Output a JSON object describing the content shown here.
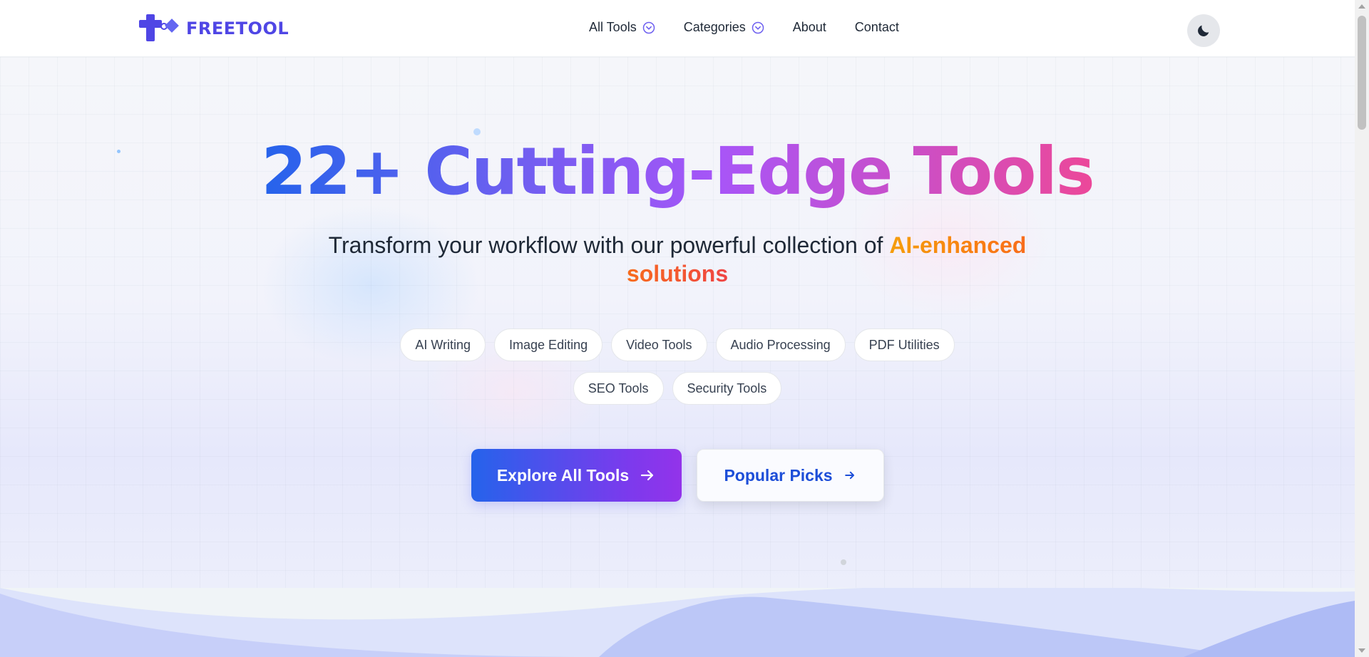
{
  "brand": {
    "name": "FREETOOL",
    "color": "#4f46e5"
  },
  "nav": {
    "items": [
      {
        "label": "All Tools",
        "has_dropdown": true
      },
      {
        "label": "Categories",
        "has_dropdown": true
      },
      {
        "label": "About",
        "has_dropdown": false
      },
      {
        "label": "Contact",
        "has_dropdown": false
      }
    ],
    "theme_toggle_icon": "moon-icon"
  },
  "hero": {
    "headline": "22+ Cutting-Edge Tools",
    "subtitle_prefix": "Transform your workflow with our powerful collection of ",
    "subtitle_accent": "AI-enhanced solutions",
    "categories": [
      "AI Writing",
      "Image Editing",
      "Video Tools",
      "Audio Processing",
      "PDF Utilities",
      "SEO Tools",
      "Security Tools"
    ],
    "primary_button": {
      "label": "Explore All Tools",
      "icon": "arrow-right-icon"
    },
    "secondary_button": {
      "label": "Popular Picks",
      "icon": "arrow-right-icon"
    }
  },
  "colors": {
    "headline_gradient": [
      "#2563eb",
      "#a855f7",
      "#ec4899"
    ],
    "accent_gradient": [
      "#f59e0b",
      "#ef4444"
    ],
    "primary_button_gradient": [
      "#2563eb",
      "#9333ea"
    ]
  }
}
